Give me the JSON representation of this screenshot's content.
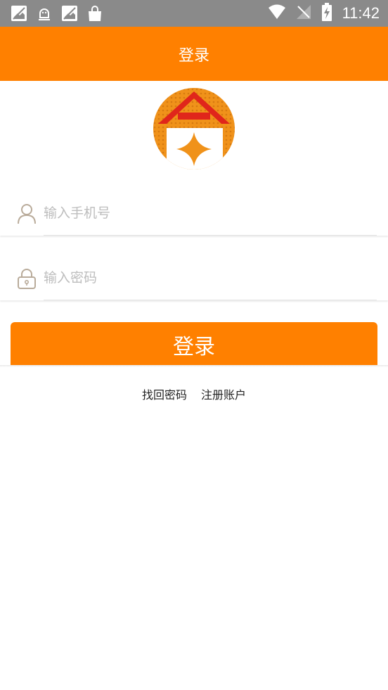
{
  "status_bar": {
    "time": "11:42",
    "left_icons": [
      "image-broken-icon",
      "android-robot-icon",
      "image-broken-icon",
      "shopping-bag-icon"
    ],
    "right_icons": [
      "wifi-icon",
      "no-signal-icon",
      "battery-charging-icon"
    ]
  },
  "header": {
    "title": "登录"
  },
  "form": {
    "phone": {
      "placeholder": "输入手机号",
      "value": ""
    },
    "password": {
      "placeholder": "输入密码",
      "value": ""
    },
    "login_label": "登录"
  },
  "links": {
    "forgot_password": "找回密码",
    "register": "注册账户"
  },
  "colors": {
    "accent": "#ff8000",
    "status_bar": "#8a8a8a",
    "icon_stroke": "#b9ab9a",
    "logo_red": "#e0261b"
  }
}
